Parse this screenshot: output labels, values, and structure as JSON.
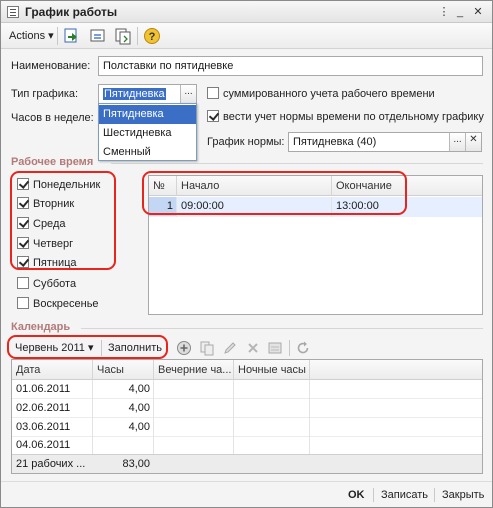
{
  "window": {
    "title": "График работы"
  },
  "toolbar": {
    "actions_label": "Actions",
    "actions_arrow": "▾"
  },
  "form": {
    "name_label": "Наименование:",
    "name_value": "Полставки по пятидневке",
    "type_label": "Тип графика:",
    "type_value": "Пятидневка",
    "hours_label": "Часов в неделе:",
    "type_options": [
      "Пятидневка",
      "Шестидневка",
      "Сменный"
    ],
    "cb_summary_label": "суммированного учета рабочего времени",
    "cb_summary_checked": false,
    "cb_norm_label": "вести учет нормы времени по отдельному графику",
    "cb_norm_checked": true,
    "norm_label": "График нормы:",
    "norm_value": "Пятидневка (40)"
  },
  "work_time": {
    "section_title": "Рабочее время",
    "days": [
      {
        "label": "Понедельник",
        "checked": true
      },
      {
        "label": "Вторник",
        "checked": true
      },
      {
        "label": "Среда",
        "checked": true
      },
      {
        "label": "Четверг",
        "checked": true
      },
      {
        "label": "Пятница",
        "checked": true
      },
      {
        "label": "Суббота",
        "checked": false
      },
      {
        "label": "Воскресенье",
        "checked": false
      }
    ],
    "grid": {
      "headers": [
        "№",
        "Начало",
        "Окончание"
      ],
      "rows": [
        {
          "num": "1",
          "start": "09:00:00",
          "end": "13:00:00"
        }
      ]
    }
  },
  "calendar": {
    "section_title": "Календарь",
    "month": "Червень 2011",
    "month_arrow": "▾",
    "fill_label": "Заполнить",
    "headers": [
      "Дата",
      "Часы",
      "Вечерние ча...",
      "Ночные часы"
    ],
    "rows": [
      {
        "date": "01.06.2011",
        "hours": "4,00"
      },
      {
        "date": "02.06.2011",
        "hours": "4,00"
      },
      {
        "date": "03.06.2011",
        "hours": "4,00"
      },
      {
        "date": "04.06.2011",
        "hours": ""
      }
    ],
    "total_days": "21 рабочих ...",
    "total_hours": "83,00"
  },
  "footer": {
    "ok": "OK",
    "save": "Записать",
    "close": "Закрыть"
  },
  "colors": {
    "accent_selection": "#3b6fc6",
    "section_title": "#b37a78",
    "annotation_red": "#e8241c"
  }
}
